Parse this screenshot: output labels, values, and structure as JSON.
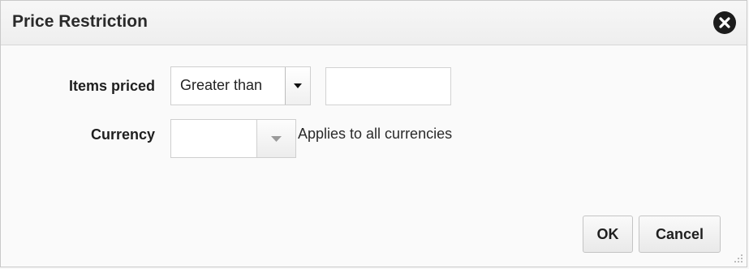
{
  "dialog": {
    "title": "Price Restriction"
  },
  "form": {
    "items_priced": {
      "label": "Items priced",
      "operator": "Greater than",
      "value": ""
    },
    "currency": {
      "label": "Currency",
      "value": "",
      "note": "Applies to all currencies"
    }
  },
  "buttons": {
    "ok": "OK",
    "cancel": "Cancel"
  },
  "icons": {
    "close": "close-icon",
    "dropdown": "chevron-down-icon",
    "resize": "resize-grip-icon"
  }
}
